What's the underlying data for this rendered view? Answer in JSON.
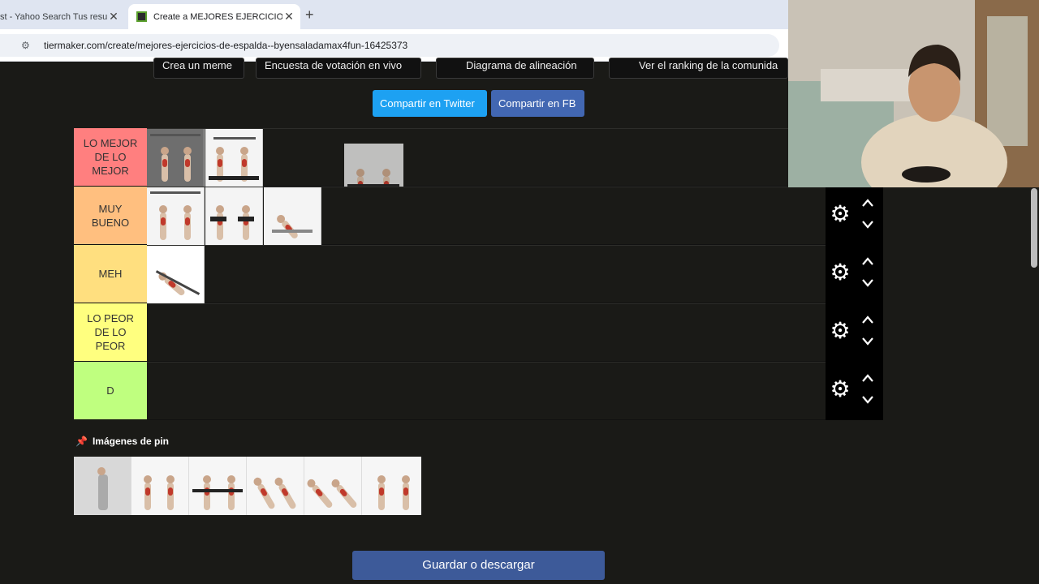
{
  "browser": {
    "tabs": [
      {
        "title": "st - Yahoo Search Tus resu",
        "active": false
      },
      {
        "title": "Create a MEJORES EJERCICIOS",
        "active": true
      }
    ],
    "url": "tiermaker.com/create/mejores-ejercicios-de-espalda--byensaladamax4fun-16425373"
  },
  "top_buttons": [
    "Crea un meme",
    "Encuesta de votación en vivo",
    "Diagrama de alineación",
    "Ver el ranking de la comunida"
  ],
  "share": {
    "twitter": "Compartir en Twitter",
    "facebook": "Compartir en FB"
  },
  "tiers": [
    {
      "label": "LO MEJOR DE LO MEJOR",
      "color": "#ff7f7f",
      "items": 2
    },
    {
      "label": "MUY BUENO",
      "color": "#ffbf7f",
      "items": 3
    },
    {
      "label": "MEH",
      "color": "#ffdf7f",
      "items": 1
    },
    {
      "label": "LO PEOR DE LO PEOR",
      "color": "#ffff7f",
      "items": 0
    },
    {
      "label": "D",
      "color": "#bfff7f",
      "items": 0
    }
  ],
  "pinned": {
    "label": "Imágenes de pin"
  },
  "save_button": "Guardar o descargar"
}
